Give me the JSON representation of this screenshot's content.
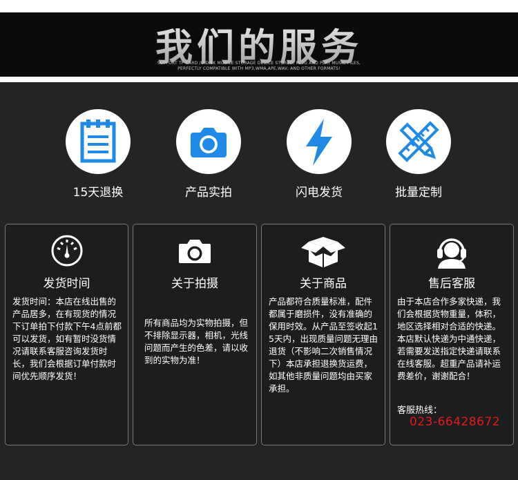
{
  "header": {
    "title": "我们的服务",
    "subtitle_line1": "SUPPORT TF CARD /U DISK MOBILE STORAGE DEVICE STORED, PLUG AND PLAY MUSIC FILES,",
    "subtitle_line2": "PERFECTLY COMPATIBLE WITH MP3,WMA,APE,WAV, AND OTHER FORMATS!"
  },
  "features": [
    {
      "label": "15天退换",
      "icon": "clipboard-icon"
    },
    {
      "label": "产品实拍",
      "icon": "camera-icon"
    },
    {
      "label": "闪电发货",
      "icon": "lightning-icon"
    },
    {
      "label": "批量定制",
      "icon": "ruler-pencil-icon"
    }
  ],
  "cards": [
    {
      "title": "发货时间",
      "icon": "speedometer-icon",
      "body": "发货时间：本店在线出售的产品居多，在有现货的情况下订单拍下付款下午4点前都可以发货，如有暂时没货情况请联系客服咨询发货时长，我们会根据订单付款时间优先顺序发货！"
    },
    {
      "title": "关于拍摄",
      "icon": "camera-icon",
      "body": "所有商品均为实物拍摄，但不排除显示器，相机，光线问题而产生的色差，请以收到的实物为准！"
    },
    {
      "title": "关于商品",
      "icon": "package-icon",
      "body": "产品都符合质量标准，配件都属于磨损件，没有准确的保用时效。从产品至签收起15天内，出现质量问题无理由退货（不影响二次销售情况下）本店承担退换货运费，如其他非质量问题均由买家承担。"
    },
    {
      "title": "售后客服",
      "icon": "customer-service-icon",
      "body": "由于本店合作多家快递，我们会根据货物重量，体积，地区选择相对合适的快递。本店默认快递为中通快递，若需要发送指定快递请联系在线客服。超重产品请补运费差价，谢谢配合！",
      "hotline_label": "客服热线：",
      "hotline": "023-66428672"
    }
  ],
  "colors": {
    "background": "#222426",
    "icon_blue": "#1e8ae6",
    "hotline_red": "#e41b1b"
  }
}
